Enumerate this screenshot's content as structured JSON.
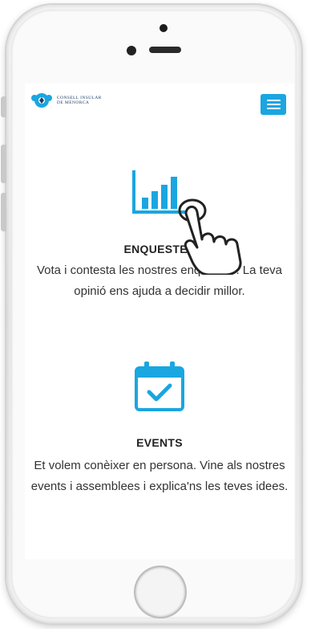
{
  "header": {
    "logo_line1": "CONSELL INSULAR",
    "logo_line2": "DE MENORCA",
    "menu_icon": "hamburger-menu-icon"
  },
  "sections": [
    {
      "icon": "bar-chart-icon",
      "title": "ENQUESTES",
      "description": "Vota i contesta les nostres enquestes. La teva opinió ens ajuda a decidir millor."
    },
    {
      "icon": "calendar-check-icon",
      "title": "EVENTS",
      "description": "Et volem conèixer en persona. Vine als nostres events i assemblees i explica'ns les teves idees."
    }
  ],
  "overlay": {
    "icon": "pointing-hand-icon"
  },
  "colors": {
    "accent": "#1aa6e0",
    "text": "#333333",
    "logo": "#1f3d66"
  }
}
